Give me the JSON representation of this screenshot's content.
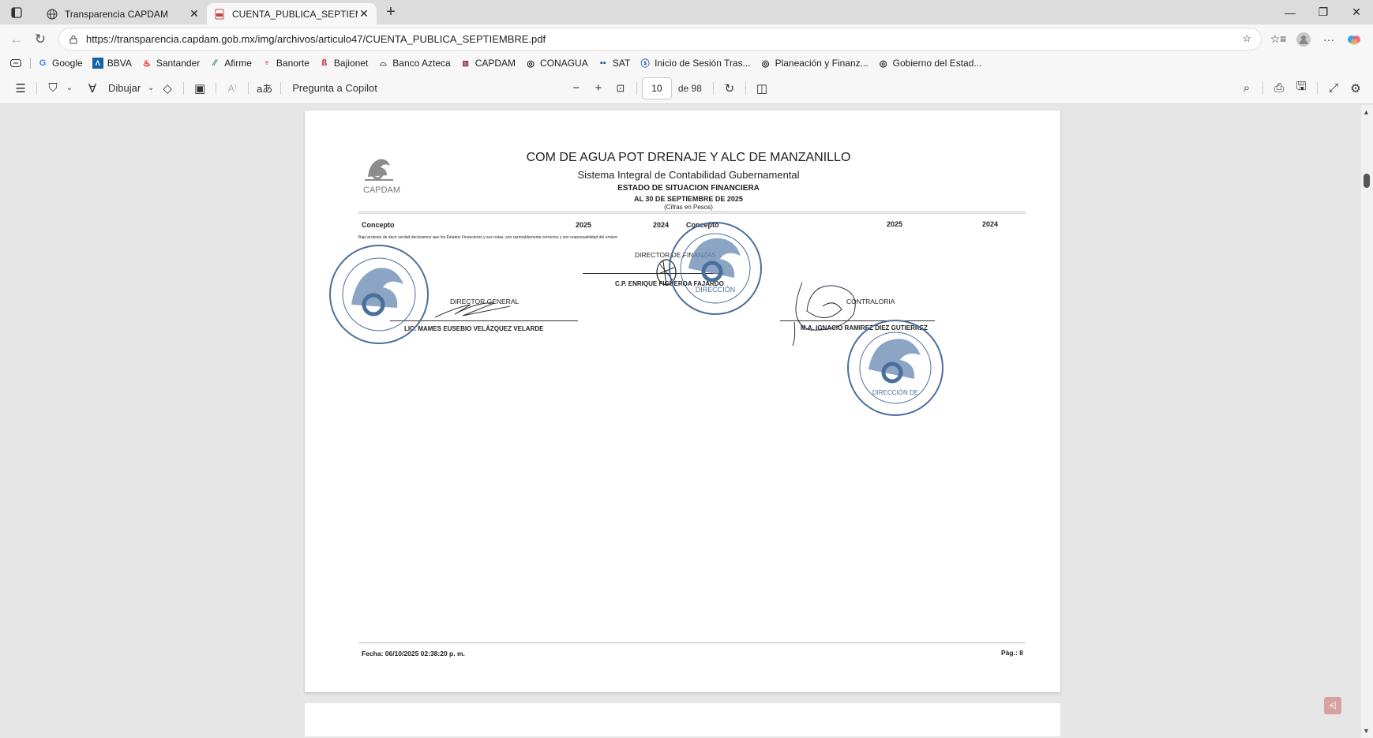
{
  "browser": {
    "tabs": [
      {
        "title": "Transparencia CAPDAM",
        "icon": "globe-icon"
      },
      {
        "title": "CUENTA_PUBLICA_SEPTIEMBRE.p",
        "icon": "pdf-icon"
      }
    ],
    "url": "https://transparencia.capdam.gob.mx/img/archivos/articulo47/CUENTA_PUBLICA_SEPTIEMBRE.pdf"
  },
  "favorites": [
    {
      "label": "Google",
      "icon": "google-icon",
      "color": "#4285F4"
    },
    {
      "label": "BBVA",
      "icon": "bbva-icon",
      "color": "#1464A5"
    },
    {
      "label": "Santander",
      "icon": "santander-icon",
      "color": "#EC0000"
    },
    {
      "label": "Afirme",
      "icon": "afirme-icon",
      "color": "#2E8B57"
    },
    {
      "label": "Banorte",
      "icon": "banorte-icon",
      "color": "#E30613"
    },
    {
      "label": "Bajionet",
      "icon": "bajionet-icon",
      "color": "#C8102E"
    },
    {
      "label": "Banco Azteca",
      "icon": "azteca-icon",
      "color": "#555555"
    },
    {
      "label": "CAPDAM",
      "icon": "capdam-icon",
      "color": "#8B2252"
    },
    {
      "label": "CONAGUA",
      "icon": "globe-icon",
      "color": "#444444"
    },
    {
      "label": "SAT",
      "icon": "sat-icon",
      "color": "#1E5BA8"
    },
    {
      "label": "Inicio de Sesión Tras...",
      "icon": "login-icon",
      "color": "#1E5BA8"
    },
    {
      "label": "Planeación y Finanz...",
      "icon": "globe-icon",
      "color": "#444444"
    },
    {
      "label": "Gobierno del Estad...",
      "icon": "globe-icon",
      "color": "#444444"
    }
  ],
  "pdf_toolbar": {
    "draw_label": "Dibujar",
    "copilot_label": "Pregunta a Copilot",
    "page_current": "10",
    "page_total": "de 98"
  },
  "document": {
    "logo_text": "CAPDAM",
    "title": "COM DE AGUA POT DRENAJE Y ALC DE MANZANILLO",
    "subtitle": "Sistema Integral de Contabilidad Gubernamental",
    "report": "ESTADO DE SITUACION FINANCIERA",
    "date": "AL 30 DE SEPTIEMBRE DE 2025",
    "units": "(Cifras en Pesos)",
    "columns": [
      "Concepto",
      "2025",
      "2024",
      "Concepto",
      "2025",
      "2024"
    ],
    "disclaimer": "Bajo protesta de decir verdad declaramos que los Estados Financieros y sus notas, son razonablemente correctos y son responsabilidad del emisor.",
    "signatories": [
      {
        "role": "DIRECTOR DE FINANZAS",
        "name": "C.P. ENRIQUE FIGUEROA FAJARDO"
      },
      {
        "role": "DIRECTOR GENERAL",
        "name": "LIC. MAMES EUSEBIO VELÁZQUEZ VELARDE"
      },
      {
        "role": "CONTRALORIA",
        "name": "M.A. IGNACIO RAMIREZ DIEZ GUTIERREZ"
      }
    ],
    "footer_date": "Fecha: 06/10/2025 02:38:20 p. m.",
    "footer_page": "Pág.: 8"
  },
  "colors": {
    "stamp": "#4a6f9a",
    "accent": "#0f6cbd"
  }
}
